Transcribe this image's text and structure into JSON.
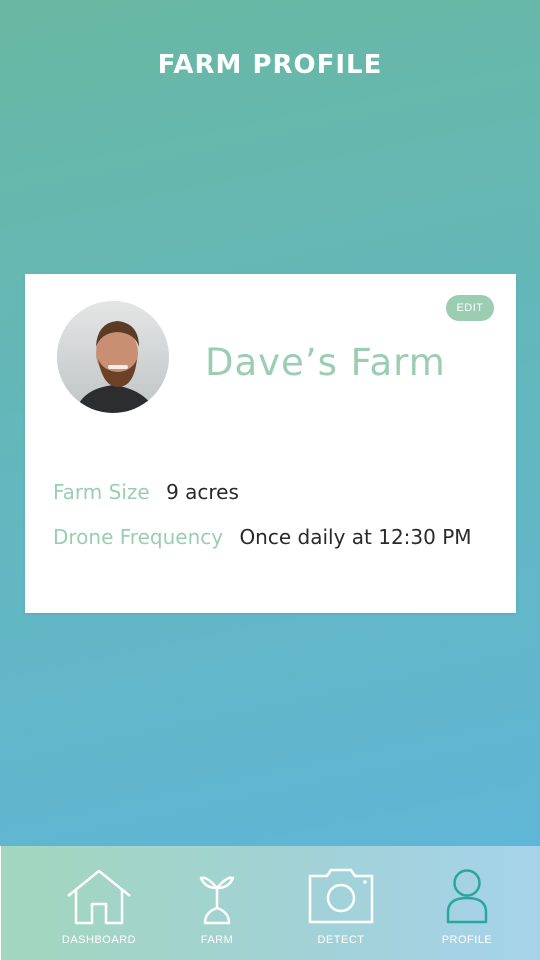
{
  "header": {
    "title": "FARM PROFILE"
  },
  "profile": {
    "name": "Dave’s Farm",
    "edit_label": "EDIT",
    "details": [
      {
        "label": "Farm Size",
        "value": "9 acres"
      },
      {
        "label": "Drone Frequency",
        "value": "Once daily at 12:30 PM"
      }
    ]
  },
  "nav": {
    "items": [
      {
        "label": "DASHBOARD",
        "icon": "house-icon"
      },
      {
        "label": "FARM",
        "icon": "sprout-icon"
      },
      {
        "label": "DETECT",
        "icon": "camera-icon"
      },
      {
        "label": "PROFILE",
        "icon": "person-icon",
        "active": true
      }
    ]
  },
  "colors": {
    "accent": "#9bcdb2",
    "active_nav": "#2aa79b",
    "text_dark": "#2a2a2a"
  }
}
